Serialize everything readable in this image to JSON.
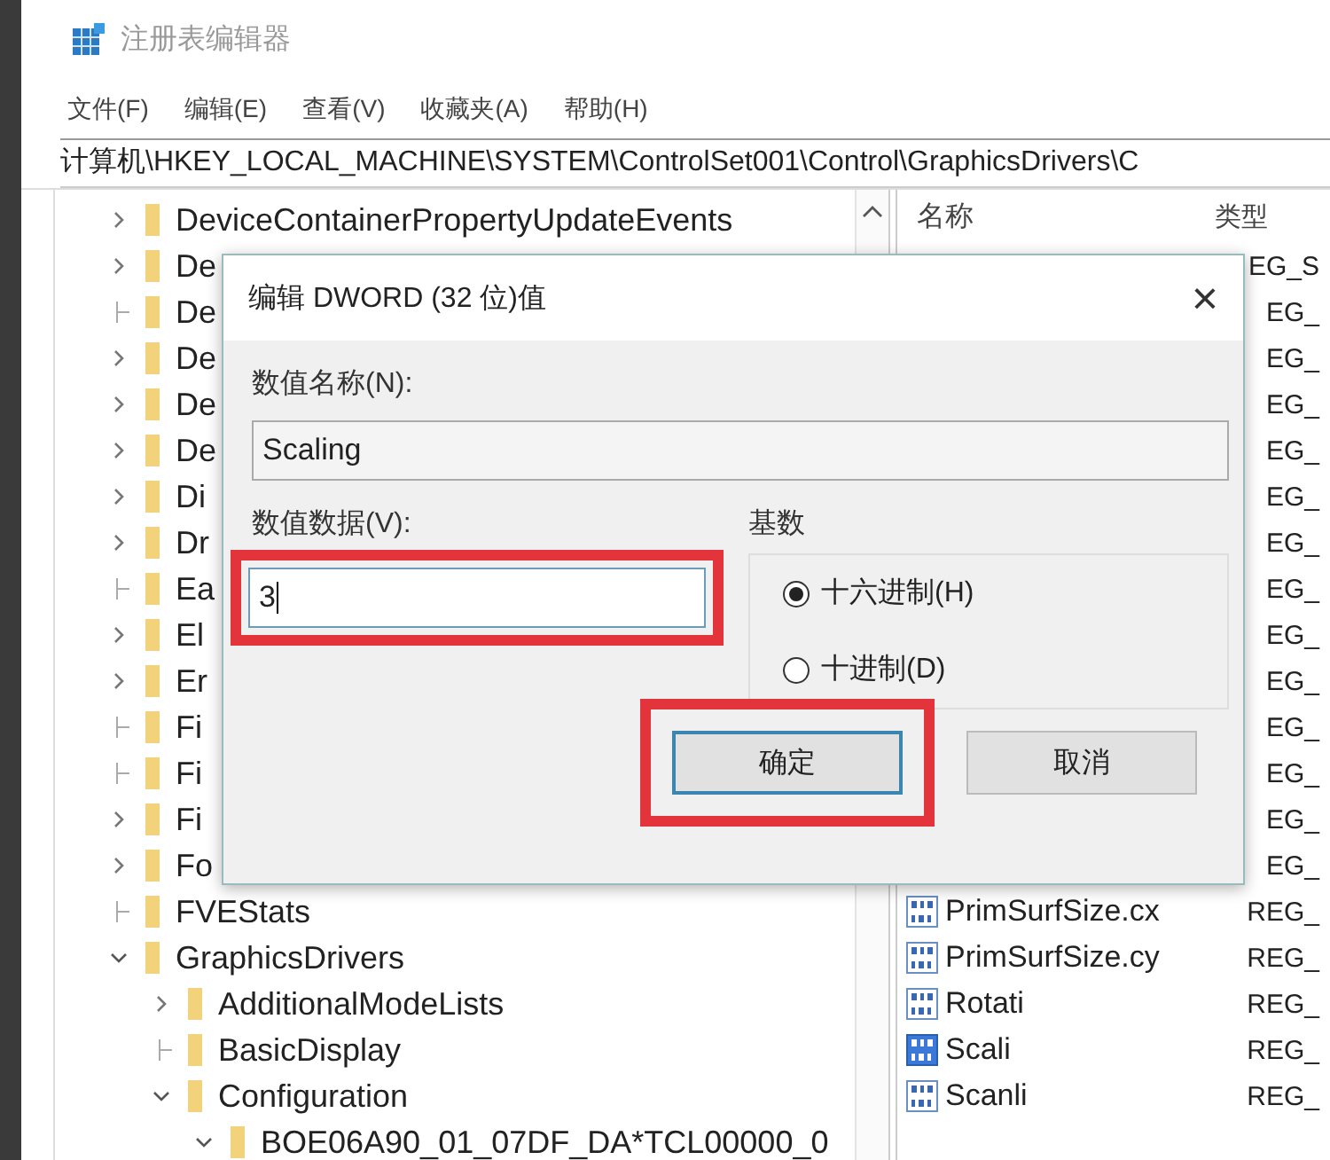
{
  "window": {
    "title": "注册表编辑器"
  },
  "menu": [
    {
      "label": "文件(F)"
    },
    {
      "label": "编辑(E)"
    },
    {
      "label": "查看(V)"
    },
    {
      "label": "收藏夹(A)"
    },
    {
      "label": "帮助(H)"
    }
  ],
  "address": "计算机\\HKEY_LOCAL_MACHINE\\SYSTEM\\ControlSet001\\Control\\GraphicsDrivers\\C",
  "tree": [
    {
      "label": "DeviceContainerPropertyUpdateEvents",
      "kind": "branch",
      "expanded": false
    },
    {
      "label": "De",
      "kind": "branch",
      "expanded": false
    },
    {
      "label": "De",
      "kind": "leaf"
    },
    {
      "label": "De",
      "kind": "branch",
      "expanded": false
    },
    {
      "label": "De",
      "kind": "branch",
      "expanded": false
    },
    {
      "label": "De",
      "kind": "branch",
      "expanded": false
    },
    {
      "label": "Di",
      "kind": "branch",
      "expanded": false
    },
    {
      "label": "Dr",
      "kind": "branch",
      "expanded": false
    },
    {
      "label": "Ea",
      "kind": "leaf"
    },
    {
      "label": "El",
      "kind": "branch",
      "expanded": false
    },
    {
      "label": "Er",
      "kind": "branch",
      "expanded": false
    },
    {
      "label": "Fi",
      "kind": "leaf"
    },
    {
      "label": "Fi",
      "kind": "leaf"
    },
    {
      "label": "Fi",
      "kind": "branch",
      "expanded": false
    },
    {
      "label": "Fo",
      "kind": "branch",
      "expanded": false
    },
    {
      "label": "FVEStats",
      "kind": "leaf"
    },
    {
      "label": "GraphicsDrivers",
      "kind": "branch",
      "expanded": true,
      "children": [
        {
          "label": "AdditionalModeLists",
          "kind": "branch",
          "expanded": false
        },
        {
          "label": "BasicDisplay",
          "kind": "leaf"
        },
        {
          "label": "Configuration",
          "kind": "branch",
          "expanded": true,
          "children": [
            {
              "label": "BOE06A90_01_07DF_DA*TCL00000_0",
              "kind": "branch",
              "expanded": true
            }
          ]
        }
      ]
    }
  ],
  "values": {
    "columns": [
      "名称",
      "类型"
    ],
    "rows": [
      {
        "type": "EG_S"
      },
      {
        "type": "EG_"
      },
      {
        "type": "EG_"
      },
      {
        "type": "EG_"
      },
      {
        "type": "EG_"
      },
      {
        "type": "EG_"
      },
      {
        "type": "EG_"
      },
      {
        "type": "EG_"
      },
      {
        "type": "EG_"
      },
      {
        "type": "EG_"
      },
      {
        "type": "EG_"
      },
      {
        "type": "EG_"
      },
      {
        "type": "EG_"
      },
      {
        "type": "EG_"
      },
      {
        "name": "PrimSurfSize.cx",
        "type": "REG_",
        "selected": false
      },
      {
        "name": "PrimSurfSize.cy",
        "type": "REG_",
        "selected": false
      },
      {
        "name": "Rotati",
        "type": "REG_",
        "selected": false
      },
      {
        "name": "Scali",
        "type": "REG_",
        "selected": true
      },
      {
        "name": "Scanli",
        "type": "REG_",
        "selected": false
      }
    ]
  },
  "dialog": {
    "title": "编辑 DWORD (32 位)值",
    "close": "×",
    "name_label": "数值名称(N):",
    "name_value": "Scaling",
    "data_label": "数值数据(V):",
    "data_value": "3",
    "data_highlighted": true,
    "base_label": "基数",
    "bases": [
      {
        "label": "十六进制(H)",
        "selected": true
      },
      {
        "label": "十进制(D)",
        "selected": false
      }
    ],
    "buttons": [
      {
        "label": "确定",
        "focused": true,
        "highlighted": true
      },
      {
        "label": "取消",
        "focused": false,
        "highlighted": false
      }
    ]
  }
}
